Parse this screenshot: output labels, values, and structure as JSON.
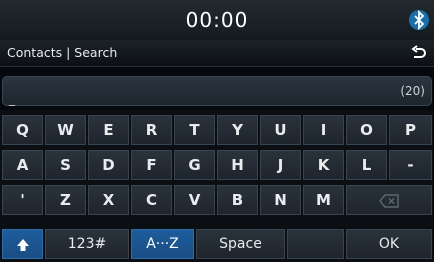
{
  "status": {
    "time": "00:00",
    "bluetooth_icon": "bluetooth-icon"
  },
  "header": {
    "title": "Contacts | Search",
    "back_icon": "back-arrow-icon"
  },
  "input": {
    "value": "_",
    "counter": "(20)"
  },
  "keyboard": {
    "row1": [
      "Q",
      "W",
      "E",
      "R",
      "T",
      "Y",
      "U",
      "I",
      "O",
      "P"
    ],
    "row2": [
      "A",
      "S",
      "D",
      "F",
      "G",
      "H",
      "J",
      "K",
      "L",
      "-"
    ],
    "row3": [
      "'",
      "Z",
      "X",
      "C",
      "V",
      "B",
      "N",
      "M"
    ],
    "bottom": {
      "mode_123": "123#",
      "mode_az": "A···Z",
      "space": "Space",
      "ok": "OK"
    }
  },
  "colors": {
    "accent": "#1b5592",
    "key": "#252d35",
    "background": "#05080c"
  }
}
